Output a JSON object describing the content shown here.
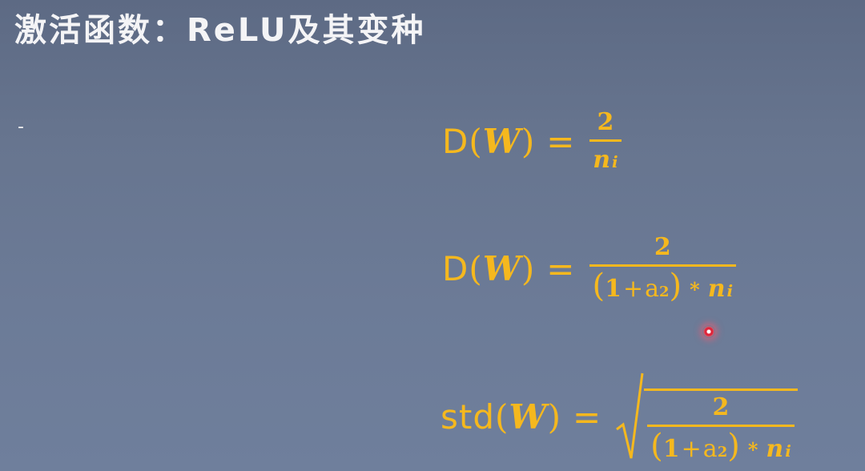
{
  "slide": {
    "title": "激活函数：ReLU及其变种",
    "bullet": "-"
  },
  "formulas": [
    {
      "lhs_func": "D",
      "lhs_var": "W",
      "equals": "=",
      "numerator": "2",
      "denominator_var": "n",
      "denominator_sub": "i"
    },
    {
      "lhs_func": "D",
      "lhs_var": "W",
      "equals": "=",
      "numerator": "2",
      "den_one": "1",
      "den_plus": "+",
      "den_a": "a",
      "den_exp": "2",
      "den_times": "*",
      "denominator_var": "n",
      "denominator_sub": "i"
    },
    {
      "lhs_func": "std",
      "lhs_var": "W",
      "equals": "=",
      "numerator": "2",
      "den_one": "1",
      "den_plus": "+",
      "den_a": "a",
      "den_exp": "2",
      "den_times": "*",
      "denominator_var": "n",
      "denominator_sub": "i"
    }
  ],
  "colors": {
    "formula": "#f5b81e",
    "title": "#f4f4f6",
    "background": "#67758f",
    "pointer": "#e0243a"
  },
  "icons": {
    "pointer": "laser-pointer-icon"
  }
}
